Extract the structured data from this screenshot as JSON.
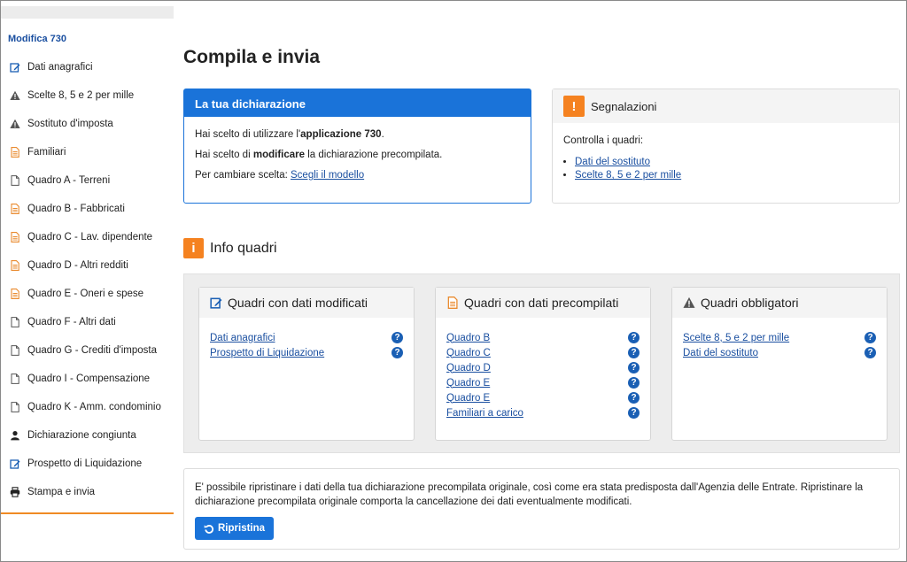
{
  "sidebar": {
    "title": "Modifica 730",
    "items": [
      {
        "label": "Dati anagrafici",
        "icon": "edit-icon"
      },
      {
        "label": "Scelte 8, 5 e 2 per mille",
        "icon": "warning-icon"
      },
      {
        "label": "Sostituto d'imposta",
        "icon": "warning-icon"
      },
      {
        "label": "Familiari",
        "icon": "document-lines-icon"
      },
      {
        "label": "Quadro A - Terreni",
        "icon": "document-icon"
      },
      {
        "label": "Quadro B - Fabbricati",
        "icon": "document-lines-icon"
      },
      {
        "label": "Quadro C - Lav. dipendente",
        "icon": "document-lines-icon"
      },
      {
        "label": "Quadro D - Altri redditi",
        "icon": "document-lines-icon"
      },
      {
        "label": "Quadro E - Oneri e spese",
        "icon": "document-lines-icon"
      },
      {
        "label": "Quadro F - Altri dati",
        "icon": "document-icon"
      },
      {
        "label": "Quadro G - Crediti d'imposta",
        "icon": "document-icon"
      },
      {
        "label": "Quadro I - Compensazione",
        "icon": "document-icon"
      },
      {
        "label": "Quadro K - Amm. condominio",
        "icon": "document-icon"
      },
      {
        "label": "Dichiarazione congiunta",
        "icon": "user-icon"
      },
      {
        "label": "Prospetto di Liquidazione",
        "icon": "edit-icon"
      },
      {
        "label": "Stampa e invia",
        "icon": "print-icon"
      }
    ]
  },
  "main": {
    "title": "Compila e invia",
    "declaration": {
      "header": "La tua dichiarazione",
      "line1_pre": "Hai scelto di utilizzare l'",
      "line1_bold": "applicazione 730",
      "line1_post": ".",
      "line2_pre": "Hai scelto di ",
      "line2_bold": "modificare",
      "line2_post": " la dichiarazione precompilata.",
      "line3_pre": "Per cambiare scelta: ",
      "line3_link": "Scegli il modello"
    },
    "warnings": {
      "header": "Segnalazioni",
      "intro": "Controlla i quadri:",
      "links": [
        "Dati del sostituto",
        "Scelte 8, 5 e 2 per mille"
      ]
    },
    "info": {
      "header": "Info quadri",
      "boxes": [
        {
          "title": "Quadri con dati modificati",
          "icon": "edit-icon",
          "links": [
            "Dati anagrafici",
            "Prospetto di Liquidazione"
          ]
        },
        {
          "title": "Quadri con dati precompilati",
          "icon": "document-lines-icon",
          "links": [
            "Quadro B",
            "Quadro C",
            "Quadro D",
            "Quadro E",
            "Quadro E",
            "Familiari a carico"
          ]
        },
        {
          "title": "Quadri obbligatori",
          "icon": "warning-icon",
          "links": [
            "Scelte 8, 5 e 2 per mille",
            "Dati del sostituto"
          ]
        }
      ]
    },
    "restore": {
      "text": "E' possibile ripristinare i dati della tua dichiarazione precompilata originale, così come era stata predisposta dall'Agenzia delle Entrate. Ripristinare la dichiarazione precompilata originale comporta la cancellazione dei dati eventualmente modificati.",
      "button": "Ripristina"
    }
  },
  "colors": {
    "accent": "#1a73d9",
    "orange": "#f58220",
    "link": "#1a4fa0"
  }
}
